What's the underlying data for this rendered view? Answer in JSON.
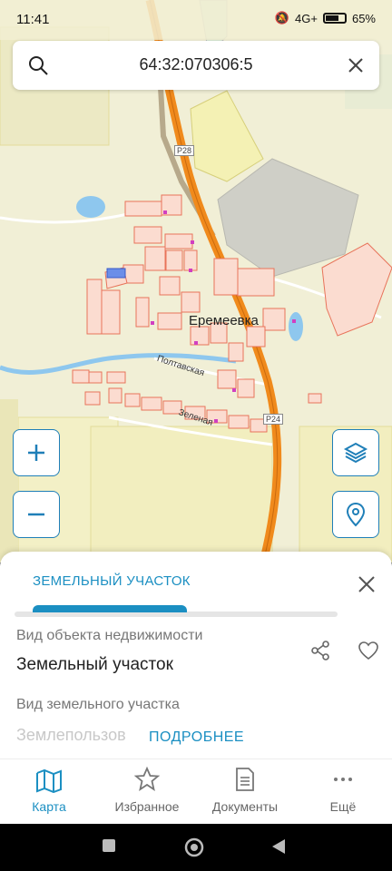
{
  "status_bar": {
    "time": "11:41",
    "network": "4G+",
    "battery": "65%"
  },
  "search": {
    "value": "64:32:070306:5"
  },
  "map": {
    "town_label": "Еремеевка",
    "street_1": "Полтавская",
    "street_2": "Зеленая",
    "road_badge_1": "Р28",
    "road_badge_2": "Р24"
  },
  "sheet": {
    "tab_label": "ЗЕМЕЛЬНЫЙ УЧАСТОК",
    "field_1_label": "Вид объекта недвижимости",
    "field_1_value": "Земельный участок",
    "field_2_label": "Вид земельного участка",
    "field_3_partial": "Землепользов",
    "more_button": "ПОДРОБНЕЕ"
  },
  "bottom_nav": {
    "items": [
      {
        "label": "Карта",
        "icon": "map-icon"
      },
      {
        "label": "Избранное",
        "icon": "star-icon"
      },
      {
        "label": "Документы",
        "icon": "document-icon"
      },
      {
        "label": "Ещё",
        "icon": "more-icon"
      }
    ]
  },
  "colors": {
    "accent": "#1b8fc2",
    "parcel_stroke": "#e8735a",
    "highway": "#f08a1c",
    "map_bg": "#f1efd6"
  }
}
